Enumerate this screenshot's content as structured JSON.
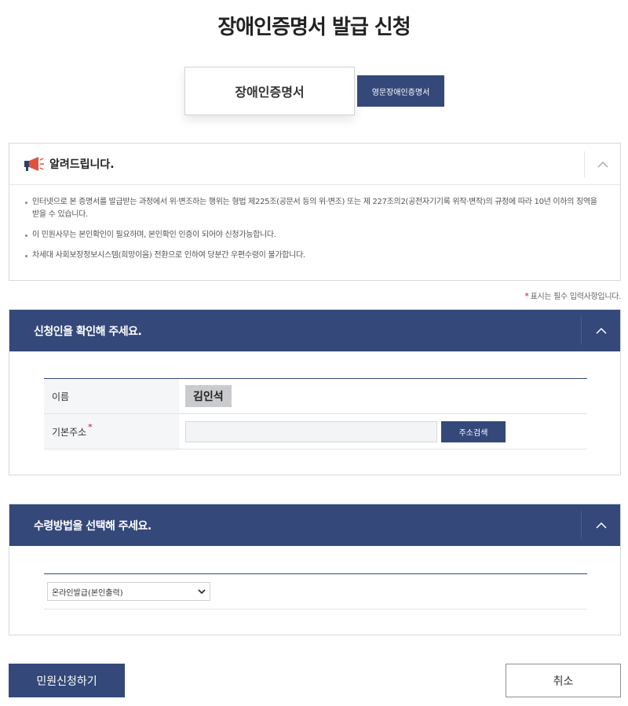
{
  "page": {
    "title": "장애인증명서 발급 신청"
  },
  "cert_tabs": {
    "main": "장애인증명서",
    "english": "영문장애인증명서"
  },
  "notice": {
    "title": "알려드립니다.",
    "items": [
      "인터넷으로 본 증명서를 발급받는 과정에서 위·변조하는 행위는 형법 제225조(공문서 등의 위·변조) 또는 제 227조의2(공전자기기록 위작·변작)의 규정에 따라 10년 이하의 징역을 받을 수 있습니다.",
      "이 민원사무는 본인확인이 필요하며, 본인확인 인증이 되어야 신청가능합니다.",
      "차세대 사회보장정보시스템(희망이음) 전환으로 인하여 당분간 우편수령이 불가합니다."
    ]
  },
  "required_note": {
    "star": "*",
    "text": "표시는 필수 입력사항입니다."
  },
  "applicant_section": {
    "title": "신청인을 확인해 주세요.",
    "name_label": "이름",
    "name_value": "김인석",
    "address_label": "기본주소",
    "address_star": "*",
    "address_value": "",
    "address_button": "주소검색"
  },
  "receive_section": {
    "title": "수령방법을 선택해 주세요.",
    "selected": "온라인발급(본인출력)"
  },
  "actions": {
    "submit": "민원신청하기",
    "cancel": "취소"
  },
  "colors": {
    "primary": "#34487a",
    "required": "#c8102e"
  },
  "icons": {
    "notice": "megaphone-icon",
    "toggle": "chevron-up-icon",
    "select": "chevron-down-icon"
  }
}
